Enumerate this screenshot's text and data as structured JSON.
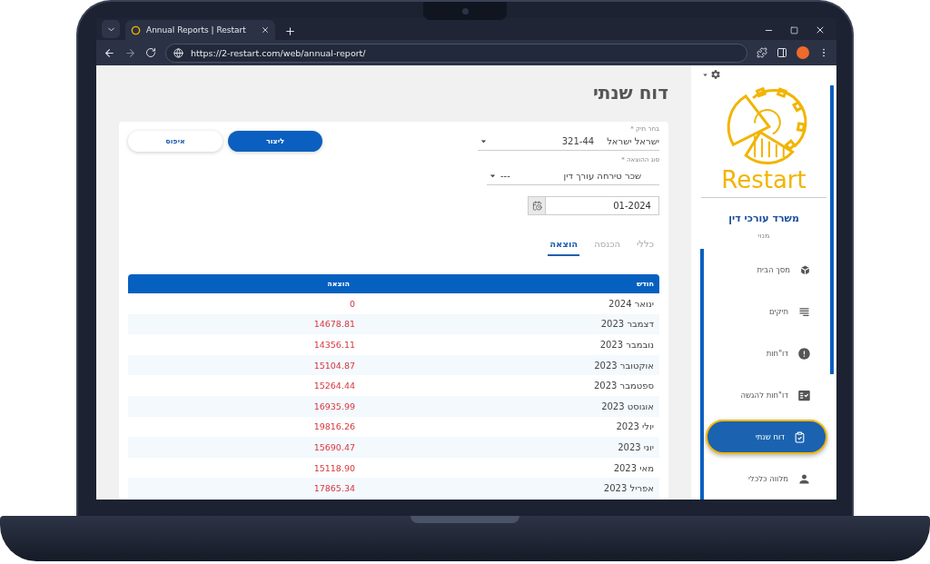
{
  "browser": {
    "tab_title": "Annual Reports | Restart",
    "url": "https://2-restart.com/web/annual-report/"
  },
  "page": {
    "title": "דוח שנתי",
    "form": {
      "file_label": "בחר תיק *",
      "file_name": "ישראל ישראל",
      "file_number": "321-44",
      "expense_label": "סוג ההוצאה *",
      "expense_value": "שכר טירחה עורך דין",
      "expense_extra": "---",
      "date": "01-2024"
    },
    "buttons": {
      "create": "ליצור",
      "reset": "איפוס"
    },
    "tabs": [
      {
        "label": "כללי",
        "selected": false
      },
      {
        "label": "הכנסה",
        "selected": false
      },
      {
        "label": "הוצאה",
        "selected": true
      }
    ],
    "table": {
      "columns": [
        "חודש",
        "הוצאה"
      ],
      "rows": [
        [
          "ינואר 2024",
          "0"
        ],
        [
          "דצמבר 2023",
          "14678.81"
        ],
        [
          "נובמבר 2023",
          "14356.11"
        ],
        [
          "אוקטובר 2023",
          "15104.87"
        ],
        [
          "ספטמבר 2023",
          "15264.44"
        ],
        [
          "אוגוסט 2023",
          "16935.99"
        ],
        [
          "יולי 2023",
          "19816.26"
        ],
        [
          "יוני 2023",
          "15690.47"
        ],
        [
          "מאי 2023",
          "15118.90"
        ],
        [
          "אפריל 2023",
          "17865.34"
        ]
      ]
    }
  },
  "sidebar": {
    "logo_text": "Restart",
    "org": "משרד עורכי דין",
    "role": "מנוי",
    "items": [
      {
        "label": "מסך הבית",
        "kind": "home",
        "selected": false
      },
      {
        "label": "תיקים",
        "kind": "files",
        "selected": false
      },
      {
        "label": "דו\"חות",
        "kind": "alert",
        "selected": false
      },
      {
        "label": "דו\"חות להגשה",
        "kind": "submit",
        "selected": false
      },
      {
        "label": "דוח שנתי",
        "kind": "annual",
        "selected": true
      },
      {
        "label": "מלווה כלכלי",
        "kind": "person",
        "selected": false
      }
    ]
  }
}
